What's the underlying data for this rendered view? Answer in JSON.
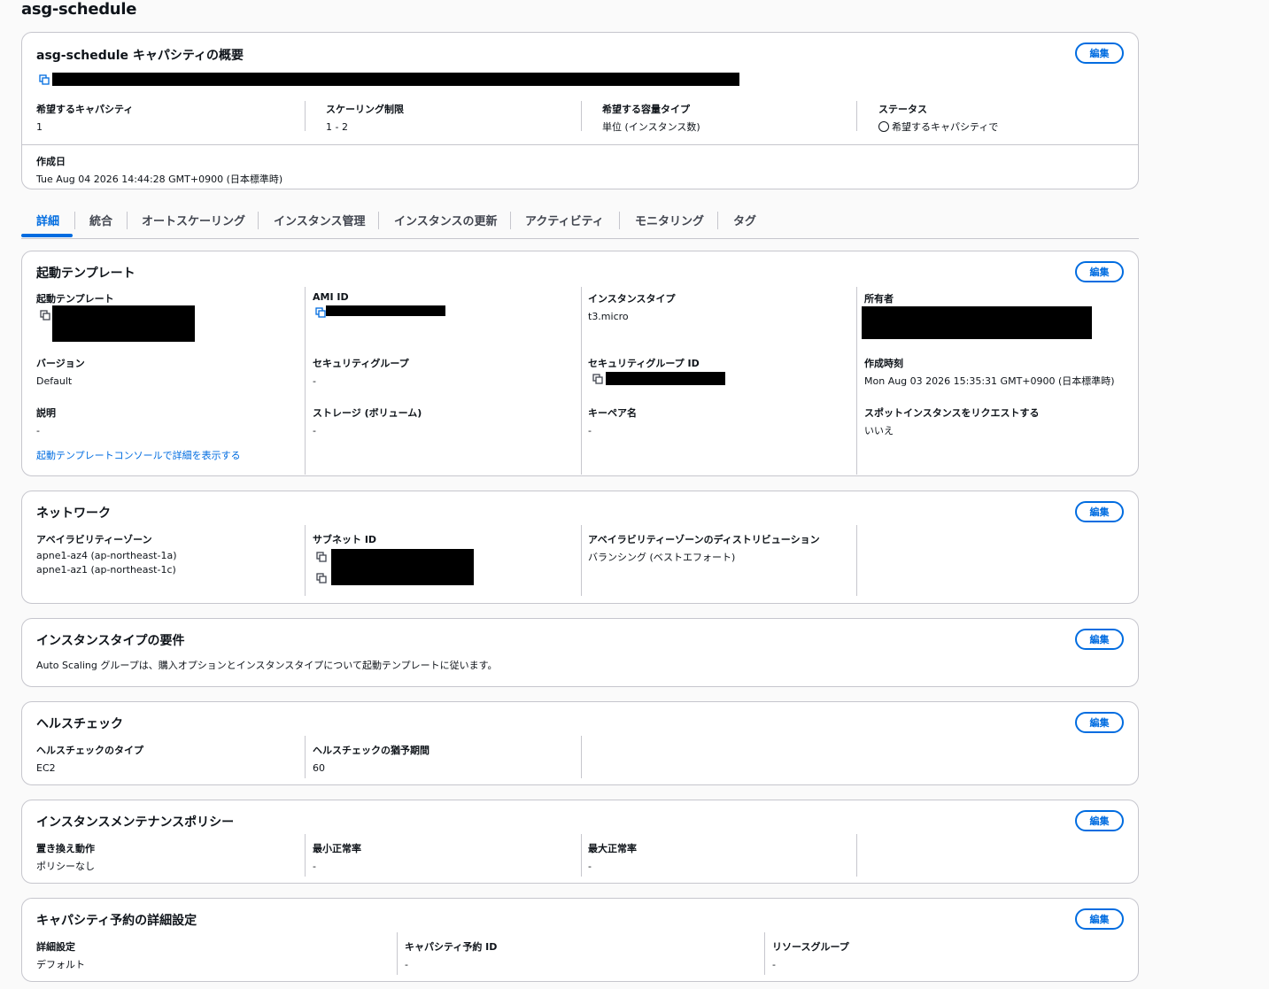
{
  "page_title": "asg-schedule",
  "edit_label": "編集",
  "overview": {
    "title": "asg-schedule キャパシティの概要",
    "desired_label": "希望するキャパシティ",
    "desired_value": "1",
    "scaling_label": "スケーリング制限",
    "scaling_value": "1 - 2",
    "capacity_type_label": "希望する容量タイプ",
    "capacity_type_value": "単位 (インスタンス数)",
    "status_label": "ステータス",
    "status_value": "希望するキャパシティで",
    "created_label": "作成日",
    "created_value": "Tue Aug 04 2026 14:44:28 GMT+0900 (日本標準時)"
  },
  "tabs": [
    "詳細",
    "統合",
    "オートスケーリング",
    "インスタンス管理",
    "インスタンスの更新",
    "アクティビティ",
    "モニタリング",
    "タグ"
  ],
  "launch_template": {
    "title": "起動テンプレート",
    "template_label": "起動テンプレート",
    "ami_label": "AMI ID",
    "instance_type_label": "インスタンスタイプ",
    "instance_type_value": "t3.micro",
    "owner_label": "所有者",
    "version_label": "バージョン",
    "version_value": "Default",
    "sg_label": "セキュリティグループ",
    "sg_value": "-",
    "sg_id_label": "セキュリティグループ ID",
    "created_label": "作成時刻",
    "created_value": "Mon Aug 03 2026 15:35:31 GMT+0900 (日本標準時)",
    "desc_label": "説明",
    "desc_value": "-",
    "storage_label": "ストレージ (ボリューム)",
    "storage_value": "-",
    "keypair_label": "キーペア名",
    "keypair_value": "-",
    "spot_label": "スポットインスタンスをリクエストする",
    "spot_value": "いいえ",
    "console_link": "起動テンプレートコンソールで詳細を表示する"
  },
  "network": {
    "title": "ネットワーク",
    "az_label": "アベイラビリティーゾーン",
    "az_values": [
      "apne1-az4 (ap-northeast-1a)",
      "apne1-az1 (ap-northeast-1c)"
    ],
    "subnet_label": "サブネット ID",
    "dist_label": "アベイラビリティーゾーンのディストリビューション",
    "dist_value": "バランシング (ベストエフォート)"
  },
  "instance_req": {
    "title": "インスタンスタイプの要件",
    "text": "Auto Scaling グループは、購入オプションとインスタンスタイプについて起動テンプレートに従います。"
  },
  "health": {
    "title": "ヘルスチェック",
    "type_label": "ヘルスチェックのタイプ",
    "type_value": "EC2",
    "grace_label": "ヘルスチェックの猶予期間",
    "grace_value": "60"
  },
  "maintenance": {
    "title": "インスタンスメンテナンスポリシー",
    "replace_label": "置き換え動作",
    "replace_value": "ポリシーなし",
    "min_label": "最小正常率",
    "min_value": "-",
    "max_label": "最大正常率",
    "max_value": "-"
  },
  "capacity_res": {
    "title": "キャパシティ予約の詳細設定",
    "detail_label": "詳細設定",
    "detail_value": "デフォルト",
    "res_id_label": "キャパシティ予約 ID",
    "res_id_value": "-",
    "rg_label": "リソースグループ",
    "rg_value": "-"
  }
}
